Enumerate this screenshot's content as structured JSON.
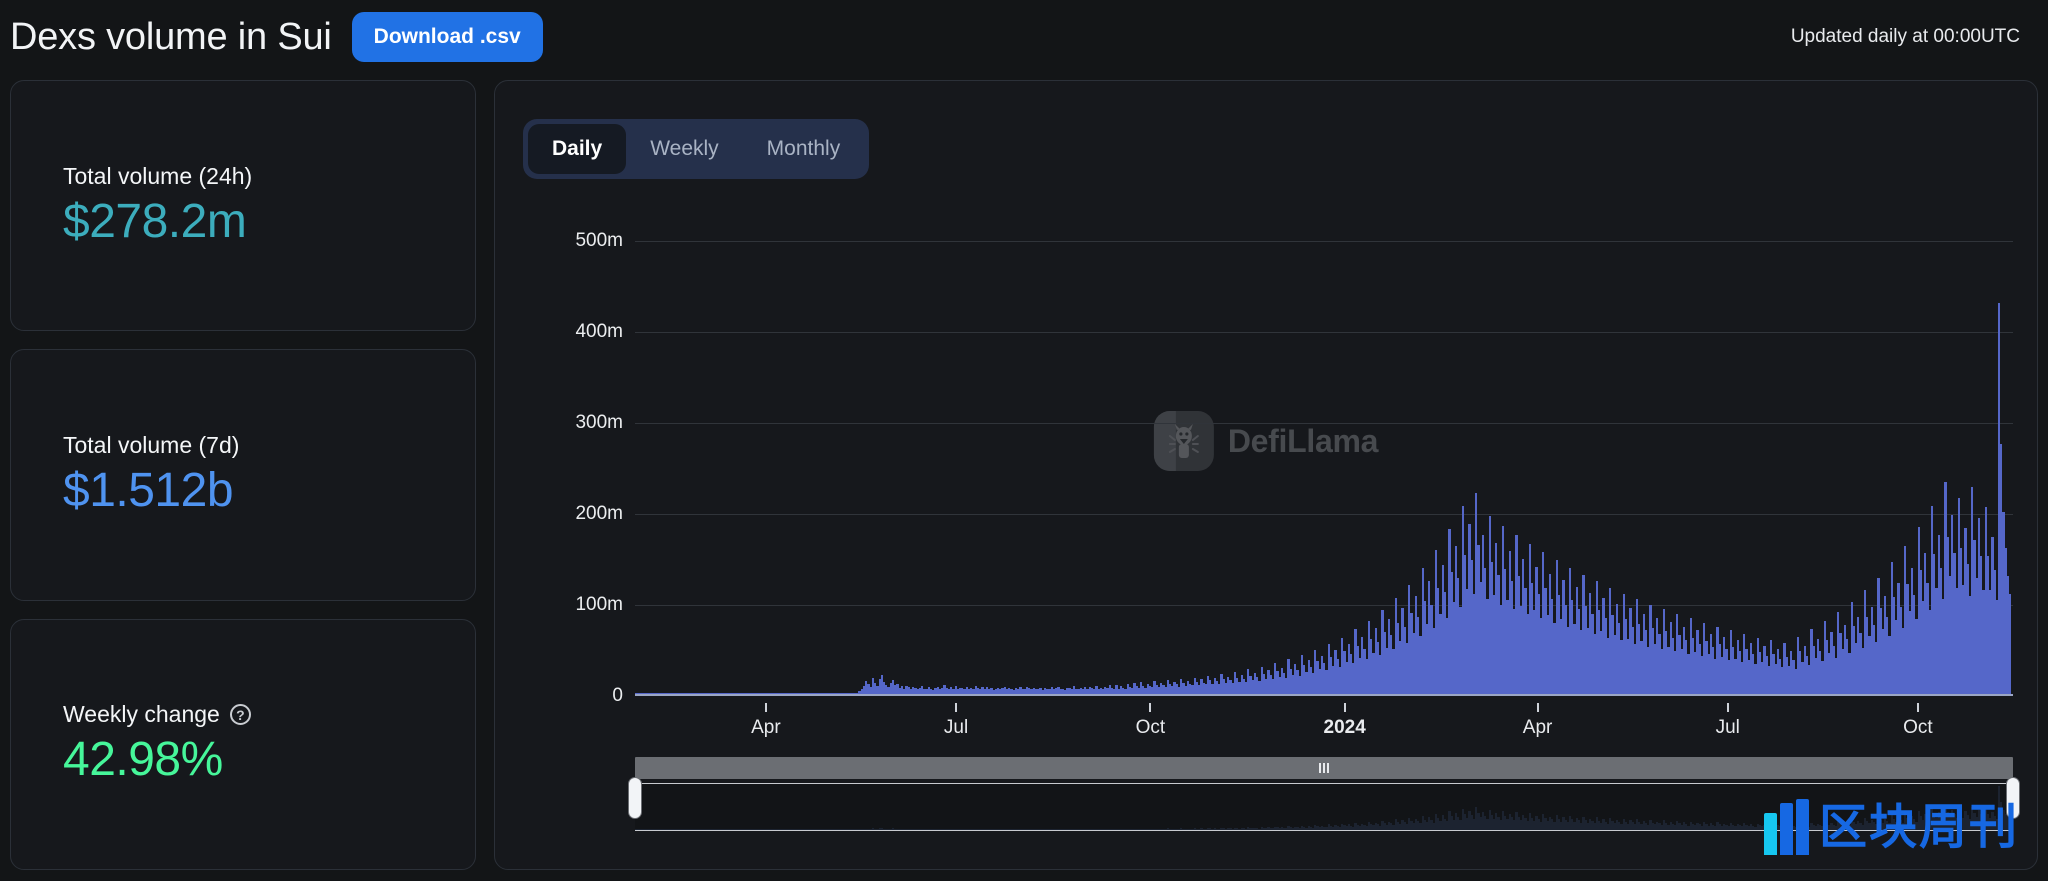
{
  "header": {
    "title": "Dexs volume in Sui",
    "download_label": "Download .csv",
    "updated_note": "Updated daily at 00:00UTC"
  },
  "sidebar": {
    "cards": [
      {
        "label": "Total volume (24h)",
        "value": "$278.2m",
        "color": "#3cadbd"
      },
      {
        "label": "Total volume (7d)",
        "value": "$1.512b",
        "color": "#4f93f0"
      },
      {
        "label": "Weekly change",
        "value": "42.98%",
        "color": "#46f69a",
        "help_icon": "question-mark-icon",
        "help_glyph": "?"
      }
    ]
  },
  "chart_panel": {
    "tabs": [
      {
        "label": "Daily",
        "active": true
      },
      {
        "label": "Weekly",
        "active": false
      },
      {
        "label": "Monthly",
        "active": false
      }
    ],
    "watermark": "DefiLlama",
    "range_slider": {
      "start_pct": 0,
      "end_pct": 100
    }
  },
  "corner_logo": {
    "text": "区块周刊"
  },
  "chart_data": {
    "type": "bar",
    "title": "Dexs volume in Sui",
    "xlabel": "",
    "ylabel": "",
    "ylim": [
      0,
      500000000
    ],
    "grid": true,
    "legend": "none",
    "series_name": "Daily DEX volume (USD)",
    "bar_color": "#5567c9",
    "y_ticks": [
      {
        "value": 0,
        "label": "0"
      },
      {
        "value": 100000000,
        "label": "100m"
      },
      {
        "value": 200000000,
        "label": "200m"
      },
      {
        "value": 300000000,
        "label": "300m"
      },
      {
        "value": 400000000,
        "label": "400m"
      },
      {
        "value": 500000000,
        "label": "500m"
      }
    ],
    "x_ticks": [
      {
        "label": "Apr",
        "pos_pct": 9.5,
        "bold": false
      },
      {
        "label": "Jul",
        "pos_pct": 23.3,
        "bold": false
      },
      {
        "label": "Oct",
        "pos_pct": 37.4,
        "bold": false
      },
      {
        "label": "2024",
        "pos_pct": 51.5,
        "bold": true
      },
      {
        "label": "Apr",
        "pos_pct": 65.5,
        "bold": false
      },
      {
        "label": "Jul",
        "pos_pct": 79.3,
        "bold": false
      },
      {
        "label": "Oct",
        "pos_pct": 93.1,
        "bold": false
      }
    ],
    "values_millions": [
      0.4,
      0.5,
      0.3,
      0.6,
      0.4,
      0.5,
      0.7,
      0.4,
      0.3,
      0.5,
      0.6,
      0.4,
      0.5,
      0.3,
      0.6,
      0.4,
      0.7,
      0.5,
      0.4,
      0.3,
      0.5,
      0.6,
      0.4,
      0.3,
      0.5,
      0.4,
      0.6,
      0.3,
      0.5,
      0.4,
      0.6,
      0.5,
      0.3,
      0.4,
      0.6,
      0.5,
      0.4,
      0.3,
      0.5,
      0.6,
      0.4,
      0.5,
      0.3,
      0.6,
      0.5,
      0.4,
      0.6,
      0.3,
      0.5,
      0.4,
      0.6,
      0.5,
      0.4,
      0.3,
      0.5,
      0.6,
      0.4,
      0.5,
      0.3,
      0.6,
      0.5,
      0.4,
      0.6,
      0.5,
      0.4,
      0.3,
      0.6,
      0.5,
      0.4,
      0.6,
      0.5,
      0.4,
      0.3,
      0.5,
      0.6,
      0.4,
      0.5,
      0.6,
      0.4,
      0.5,
      0.6,
      0.4,
      0.3,
      0.5,
      0.6,
      0.4,
      0.5,
      0.3,
      0.6,
      0.5,
      0.4,
      0.6,
      0.5,
      0.4,
      0.3,
      0.5,
      0.6,
      0.4,
      0.5,
      0.6,
      3.0,
      5.5,
      9.0,
      14.0,
      11.0,
      7.5,
      18.0,
      12.5,
      9.0,
      16.0,
      21.0,
      13.0,
      10.0,
      8.0,
      12.0,
      15.0,
      9.5,
      11.0,
      7.0,
      8.5,
      6.0,
      9.0,
      7.5,
      5.5,
      8.0,
      6.5,
      5.0,
      7.0,
      9.0,
      6.0,
      5.5,
      7.5,
      6.0,
      4.5,
      6.5,
      8.0,
      5.5,
      7.0,
      9.5,
      6.5,
      5.0,
      7.5,
      6.0,
      8.5,
      5.5,
      7.0,
      6.5,
      5.0,
      8.0,
      6.0,
      7.0,
      5.5,
      9.0,
      6.5,
      5.0,
      7.5,
      6.0,
      8.0,
      5.5,
      6.5,
      4.5,
      6.0,
      7.0,
      5.0,
      6.5,
      8.0,
      5.5,
      7.0,
      6.0,
      4.5,
      6.5,
      5.0,
      7.5,
      6.0,
      5.5,
      8.0,
      6.5,
      5.0,
      7.0,
      6.0,
      5.0,
      6.5,
      4.5,
      7.0,
      5.5,
      6.0,
      8.0,
      5.0,
      6.5,
      7.5,
      5.5,
      6.0,
      4.5,
      7.0,
      6.5,
      5.0,
      8.5,
      6.0,
      5.5,
      7.0,
      6.0,
      8.0,
      5.5,
      7.5,
      6.5,
      5.0,
      9.0,
      6.0,
      7.0,
      5.5,
      8.0,
      6.5,
      10.0,
      7.0,
      5.5,
      9.5,
      6.0,
      8.5,
      7.0,
      6.0,
      11.0,
      8.0,
      6.5,
      12.0,
      9.0,
      7.0,
      13.5,
      8.5,
      6.5,
      10.5,
      9.0,
      7.5,
      14.0,
      10.0,
      8.0,
      12.5,
      9.5,
      7.5,
      15.0,
      11.0,
      8.5,
      13.0,
      10.5,
      8.0,
      16.0,
      12.0,
      9.0,
      14.5,
      11.5,
      9.5,
      18.0,
      13.5,
      10.0,
      16.5,
      12.5,
      10.5,
      20.0,
      15.0,
      11.0,
      17.5,
      14.0,
      11.5,
      22.0,
      16.0,
      12.5,
      19.0,
      15.5,
      12.0,
      24.0,
      18.0,
      13.5,
      21.0,
      17.0,
      13.0,
      27.0,
      20.0,
      15.0,
      23.5,
      19.0,
      14.5,
      30.0,
      22.5,
      17.0,
      26.0,
      21.0,
      16.0,
      34.0,
      25.0,
      19.0,
      29.0,
      23.5,
      18.0,
      38.0,
      28.0,
      21.0,
      33.0,
      26.5,
      20.0,
      43.0,
      32.0,
      24.0,
      37.0,
      30.0,
      23.0,
      48.0,
      36.0,
      27.0,
      42.0,
      34.0,
      26.0,
      55.0,
      41.0,
      31.0,
      48.0,
      39.0,
      30.0,
      62.0,
      47.0,
      35.0,
      55.0,
      44.0,
      34.0,
      71.0,
      53.0,
      40.0,
      63.0,
      50.0,
      38.0,
      80.0,
      60.0,
      45.0,
      72.0,
      57.0,
      43.0,
      92.0,
      68.0,
      51.0,
      82.0,
      65.0,
      49.0,
      105.0,
      78.0,
      58.0,
      94.0,
      74.0,
      56.0,
      120.0,
      89.0,
      67.0,
      108.0,
      85.0,
      64.0,
      138.0,
      102.0,
      77.0,
      124.0,
      98.0,
      73.0,
      158.0,
      117.0,
      88.0,
      142.0,
      112.0,
      84.0,
      181.0,
      134.0,
      101.0,
      163.0,
      128.0,
      96.0,
      207.0,
      153.0,
      115.0,
      187.0,
      147.0,
      110.0,
      221.0,
      164.0,
      123.0,
      175.0,
      138.0,
      104.0,
      196.0,
      145.0,
      109.0,
      166.0,
      131.0,
      98.0,
      185.0,
      137.0,
      103.0,
      157.0,
      124.0,
      93.0,
      175.0,
      130.0,
      97.0,
      148.0,
      117.0,
      88.0,
      165.0,
      122.0,
      92.0,
      140.0,
      110.0,
      83.0,
      156.0,
      116.0,
      87.0,
      132.0,
      104.0,
      78.0,
      147.0,
      109.0,
      82.0,
      125.0,
      98.0,
      74.0,
      139.0,
      103.0,
      77.0,
      118.0,
      93.0,
      70.0,
      131.0,
      97.0,
      73.0,
      111.0,
      88.0,
      66.0,
      124.0,
      92.0,
      69.0,
      105.0,
      83.0,
      62.0,
      117.0,
      87.0,
      65.0,
      99.0,
      78.0,
      59.0,
      110.0,
      82.0,
      61.0,
      94.0,
      74.0,
      55.0,
      104.0,
      77.0,
      58.0,
      88.0,
      70.0,
      52.0,
      98.0,
      73.0,
      55.0,
      83.0,
      66.0,
      49.0,
      93.0,
      69.0,
      52.0,
      79.0,
      62.0,
      47.0,
      88.0,
      65.0,
      49.0,
      74.0,
      59.0,
      44.0,
      83.0,
      62.0,
      46.0,
      70.0,
      55.0,
      42.0,
      78.0,
      58.0,
      44.0,
      66.0,
      52.0,
      39.0,
      74.0,
      55.0,
      41.0,
      63.0,
      49.0,
      37.0,
      70.0,
      52.0,
      39.0,
      59.0,
      47.0,
      35.0,
      66.0,
      49.0,
      37.0,
      56.0,
      44.0,
      33.0,
      62.0,
      46.0,
      35.0,
      53.0,
      42.0,
      31.0,
      59.0,
      44.0,
      33.0,
      50.0,
      39.0,
      30.0,
      56.0,
      41.0,
      31.0,
      47.0,
      37.0,
      28.0,
      63.0,
      47.0,
      35.0,
      53.0,
      42.0,
      32.0,
      71.0,
      53.0,
      40.0,
      60.0,
      47.0,
      36.0,
      80.0,
      59.0,
      45.0,
      68.0,
      53.0,
      40.0,
      90.0,
      67.0,
      50.0,
      76.0,
      60.0,
      45.0,
      101.0,
      75.0,
      56.0,
      85.0,
      67.0,
      51.0,
      114.0,
      85.0,
      64.0,
      96.0,
      76.0,
      57.0,
      128.0,
      95.0,
      71.0,
      108.0,
      85.0,
      64.0,
      145.0,
      107.0,
      81.0,
      122.0,
      96.0,
      72.0,
      163.0,
      121.0,
      91.0,
      138.0,
      109.0,
      82.0,
      184.0,
      136.0,
      102.0,
      155.0,
      122.0,
      92.0,
      207.0,
      154.0,
      116.0,
      175.0,
      138.0,
      104.0,
      233.0,
      173.0,
      130.0,
      197.0,
      155.0,
      117.0,
      215.0,
      160.0,
      120.0,
      182.0,
      143.0,
      108.0,
      228.0,
      169.0,
      127.0,
      193.0,
      152.0,
      114.0,
      205.0,
      152.0,
      114.0,
      173.0,
      136.0,
      103.0,
      430.0,
      275.0,
      200.0,
      160.0,
      130.0,
      110.0
    ]
  }
}
